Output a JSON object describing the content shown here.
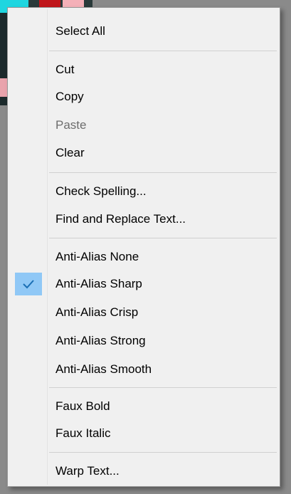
{
  "menu": {
    "groups": {
      "select": {
        "select_all": "Select All"
      },
      "edit": {
        "cut": "Cut",
        "copy": "Copy",
        "paste": "Paste",
        "clear": "Clear"
      },
      "tools": {
        "check_spelling": "Check Spelling...",
        "find_replace": "Find and Replace Text..."
      },
      "anti_alias": {
        "none": "Anti-Alias None",
        "sharp": "Anti-Alias Sharp",
        "crisp": "Anti-Alias Crisp",
        "strong": "Anti-Alias Strong",
        "smooth": "Anti-Alias Smooth",
        "checked": "sharp"
      },
      "faux": {
        "bold": "Faux Bold",
        "italic": "Faux Italic"
      },
      "warp": {
        "warp_text": "Warp Text..."
      }
    },
    "disabled_items": [
      "paste"
    ],
    "check_icon": "checkmark-icon",
    "colors": {
      "menu_bg": "#f0f0f0",
      "check_highlight": "#90c8f6",
      "check_mark": "#1a6fb5",
      "disabled_text": "#6d6d6d"
    }
  }
}
